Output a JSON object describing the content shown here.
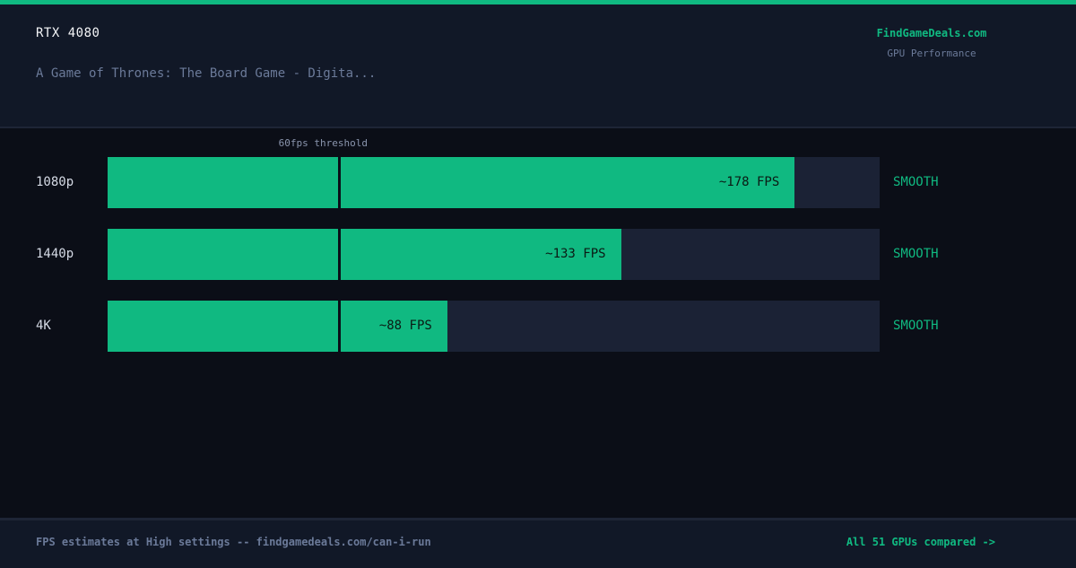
{
  "header": {
    "gpu": "RTX 4080",
    "game": "A Game of Thrones: The Board Game - Digita...",
    "brand": "FindGameDeals.com",
    "brand_sub": "GPU Performance"
  },
  "chart_data": {
    "type": "bar",
    "orientation": "horizontal",
    "categories": [
      "1080p",
      "1440p",
      "4K"
    ],
    "values": [
      178,
      133,
      88
    ],
    "value_labels": [
      "~178 FPS",
      "~133 FPS",
      "~88 FPS"
    ],
    "status": [
      "SMOOTH",
      "SMOOTH",
      "SMOOTH"
    ],
    "threshold": {
      "value": 60,
      "label": "60fps threshold"
    },
    "xlim": [
      0,
      200
    ],
    "colors": {
      "bar": "#10b981",
      "track": "#1b2235",
      "status": "#10b981"
    }
  },
  "footer": {
    "note": "FPS estimates at High settings -- findgamedeals.com/can-i-run",
    "link": "All 51 GPUs compared ->"
  }
}
